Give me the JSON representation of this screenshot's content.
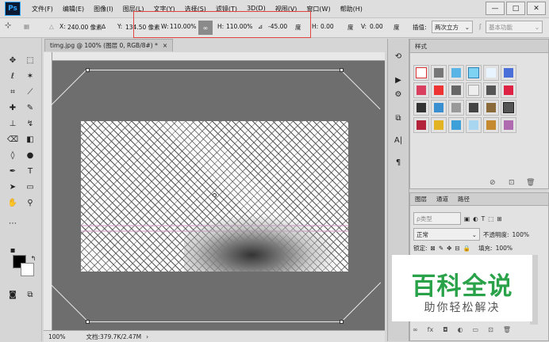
{
  "app": {
    "logo": "Ps"
  },
  "menu": [
    "文件(F)",
    "编辑(E)",
    "图像(I)",
    "图层(L)",
    "文字(Y)",
    "选择(S)",
    "滤镜(T)",
    "3D(D)",
    "视图(V)",
    "窗口(W)",
    "帮助(H)"
  ],
  "window_buttons": [
    "—",
    "□",
    "✕"
  ],
  "options": {
    "x_label": "X:",
    "x_value": "240.00 像素",
    "y_label": "Y:",
    "y_value": "134.50 像素",
    "w_label": "W:",
    "w_value": "110.00%",
    "h_label": "H:",
    "h_value": "110.00%",
    "angle_value": "-45.00",
    "angle_unit": "度",
    "skew_h_label": "H:",
    "skew_h_value": "0.00",
    "skew_h_unit": "度",
    "skew_v_label": "V:",
    "skew_v_value": "0.00",
    "skew_v_unit": "度",
    "interp_label": "插值:",
    "interp_value": "两次立方",
    "workspace": "基本功能"
  },
  "document": {
    "tab_title": "timg.jpg @ 100% (图层 0, RGB/8#) *",
    "tab_close": "×",
    "zoom": "100%",
    "doc_info": "文档:379.7K/2.47M"
  },
  "styles_panel": {
    "title": "样式"
  },
  "layers_panel": {
    "tabs": [
      "图层",
      "通道",
      "路径"
    ],
    "kind_label": "ρ类型",
    "blend_mode": "正常",
    "opacity_label": "不透明度:",
    "opacity_value": "100%",
    "lock_label": "锁定:",
    "fill_label": "填充:",
    "fill_value": "100%"
  },
  "watermark": {
    "main": "百科全说",
    "sub": "助你轻松解决"
  },
  "colors": {
    "accent_red": "#e0443e",
    "watermark_green": "#2aa24a"
  }
}
